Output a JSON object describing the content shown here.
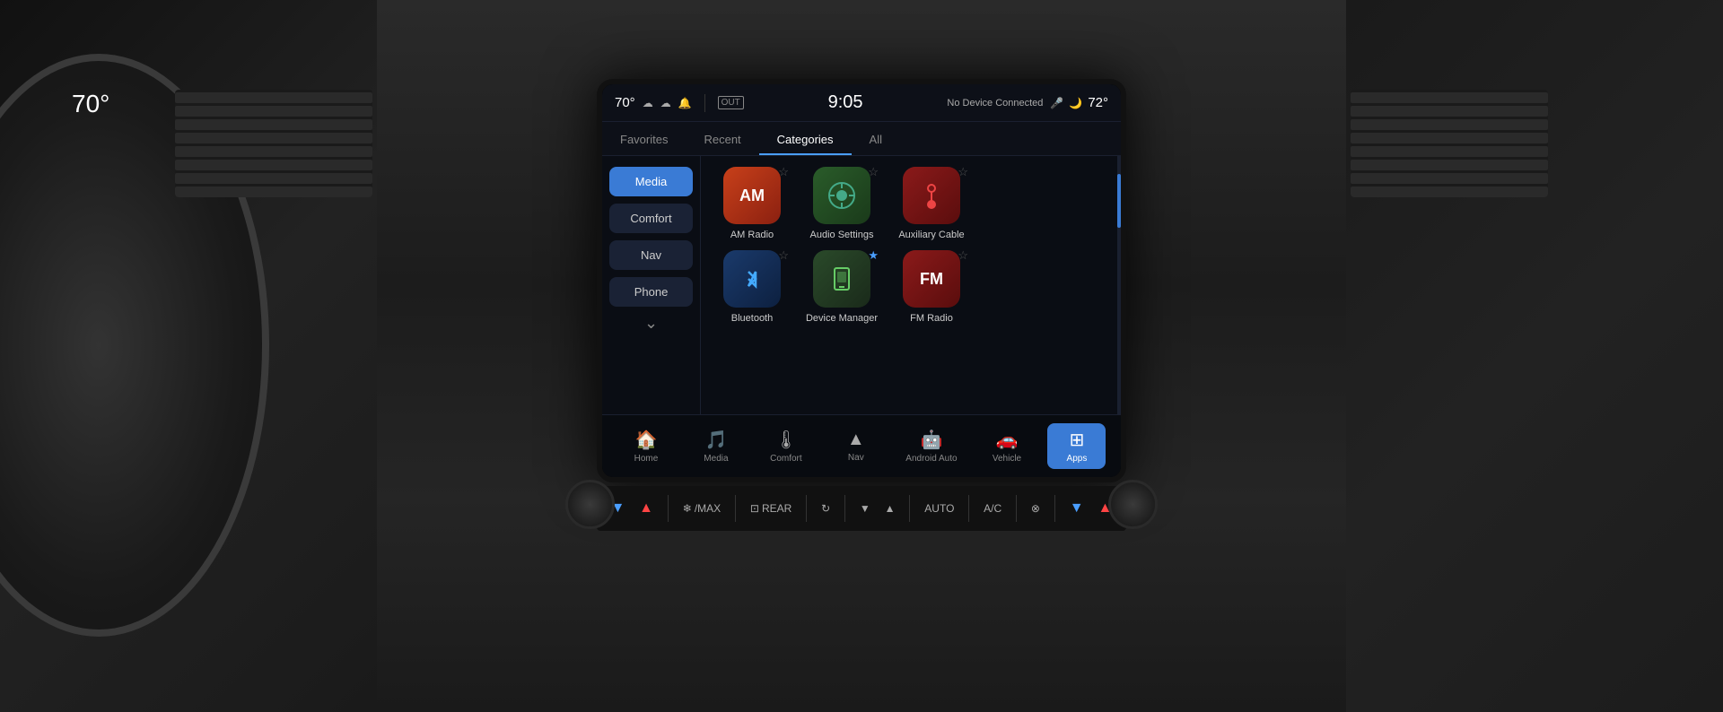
{
  "status_bar": {
    "temp_outside": "70°",
    "icons": [
      "☁️",
      "🔔"
    ],
    "out_label": "OUT",
    "time": "9:05",
    "device_status": "No Device Connected",
    "mic_icon": "🎤",
    "temp_inside": "72°"
  },
  "nav_tabs": [
    {
      "label": "Favorites",
      "active": false
    },
    {
      "label": "Recent",
      "active": false
    },
    {
      "label": "Categories",
      "active": true
    },
    {
      "label": "All",
      "active": false
    }
  ],
  "sidebar": {
    "buttons": [
      {
        "label": "Media",
        "active": true
      },
      {
        "label": "Comfort",
        "active": false
      },
      {
        "label": "Nav",
        "active": false
      },
      {
        "label": "Phone",
        "active": false
      }
    ],
    "more_icon": "⌄"
  },
  "apps_row1": [
    {
      "label": "AM Radio",
      "icon": "AM",
      "icon_class": "icon-am",
      "star": "☆",
      "star_filled": false
    },
    {
      "label": "Audio Settings",
      "icon": "⚙",
      "icon_class": "icon-audio",
      "star": "☆",
      "star_filled": false
    },
    {
      "label": "Auxiliary Cable",
      "icon": "🎵",
      "icon_class": "icon-aux",
      "star": "☆",
      "star_filled": false
    }
  ],
  "apps_row2": [
    {
      "label": "Bluetooth",
      "icon": "🔵",
      "icon_class": "icon-bt",
      "star": "☆",
      "star_filled": false
    },
    {
      "label": "Device Manager",
      "icon": "📱",
      "icon_class": "icon-device",
      "star": "★",
      "star_filled": true
    },
    {
      "label": "FM Radio",
      "icon": "FM",
      "icon_class": "icon-fm",
      "star": "☆",
      "star_filled": false
    }
  ],
  "taskbar": {
    "items": [
      {
        "icon": "🏠",
        "label": "Home",
        "active": false
      },
      {
        "icon": "🎵",
        "label": "Media",
        "active": false
      },
      {
        "icon": "🌡",
        "label": "Comfort",
        "active": false
      },
      {
        "icon": "⬆",
        "label": "Nav",
        "active": false
      },
      {
        "icon": "🤖",
        "label": "Android Auto",
        "active": false
      },
      {
        "icon": "🚗",
        "label": "Vehicle",
        "active": false
      },
      {
        "icon": "⊞",
        "label": "Apps",
        "active": true
      }
    ]
  },
  "controls": {
    "items": [
      {
        "label": "MAX",
        "icon": "❄",
        "prefix_arrow": "⌄⌃",
        "color": "blue"
      },
      {
        "label": "REAR",
        "icon": "⊡",
        "color": "normal"
      },
      {
        "label": "",
        "icon": "⊗",
        "color": "normal"
      },
      {
        "label": "",
        "arrows": "⌄ ⌃",
        "color": "normal"
      },
      {
        "label": "AUTO",
        "color": "normal"
      },
      {
        "label": "A/C",
        "color": "normal"
      },
      {
        "label": "",
        "icon": "⊗",
        "color": "normal"
      },
      {
        "label": "",
        "arrows": "⌄ ⌃",
        "blue_down": true,
        "red_up": true
      }
    ]
  },
  "colors": {
    "accent_blue": "#3a7bd5",
    "screen_bg": "#0a0d14",
    "status_bg": "#0d1018",
    "sidebar_active": "#3a7bd5"
  }
}
